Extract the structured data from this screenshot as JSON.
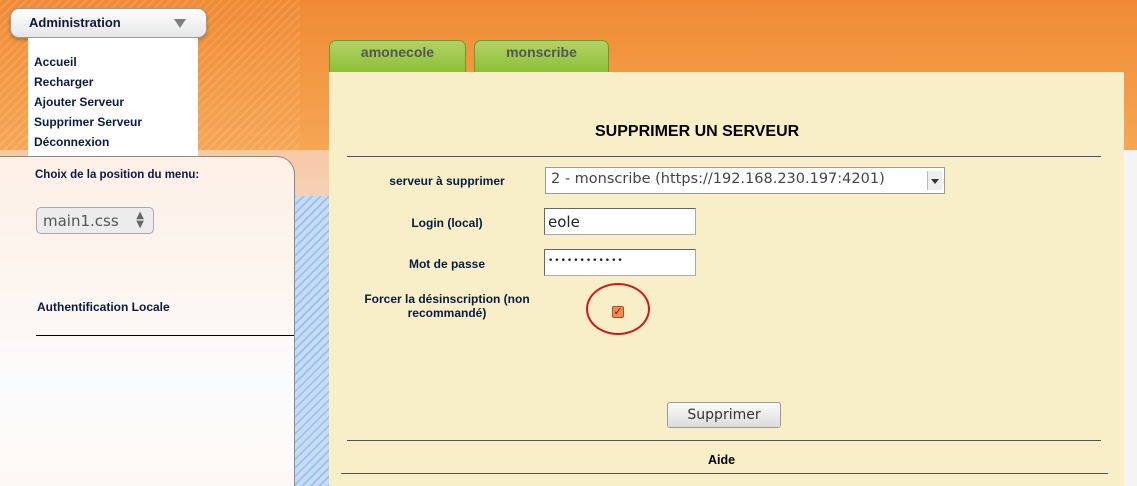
{
  "sidebar": {
    "header_label": "Administration",
    "menu_items": [
      {
        "label": "Accueil"
      },
      {
        "label": "Recharger"
      },
      {
        "label": "Ajouter Serveur"
      },
      {
        "label": "Supprimer Serveur"
      },
      {
        "label": "Déconnexion"
      }
    ],
    "menu_position_label": "Choix de la position du menu:",
    "menu_css_select_value": "main1.css",
    "auth_label": "Authentification Locale"
  },
  "server_tabs": [
    {
      "label": "amonecole"
    },
    {
      "label": "monscribe"
    }
  ],
  "main": {
    "title": "SUPPRIMER UN SERVEUR",
    "fields": {
      "server_label": "serveur à supprimer",
      "server_value": "2 - monscribe (https://192.168.230.197:4201)",
      "login_label": "Login (local)",
      "login_value": "eole",
      "password_label": "Mot de passe",
      "password_value": "••••••••••••",
      "force_label": "Forcer la désinscription (non recommandé)",
      "force_checked": true
    },
    "submit_label": "Supprimer",
    "help_label": "Aide"
  },
  "colors": {
    "accent_orange": "#f08a35",
    "tab_green": "#8cc037",
    "content_bg": "#f8efc9",
    "annotation_red": "#d21818"
  }
}
